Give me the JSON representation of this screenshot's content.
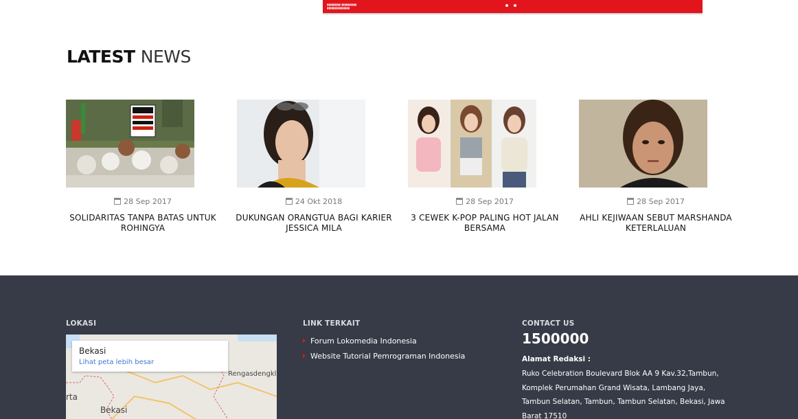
{
  "latest": {
    "title_bold": "LATEST",
    "title_light": "NEWS"
  },
  "news": [
    {
      "date": "28 Sep 2017",
      "title": "SOLIDARITAS TANPA BATAS UNTUK ROHINGYA"
    },
    {
      "date": "24 Okt 2018",
      "title": "DUKUNGAN ORANGTUA BAGI KARIER JESSICA MILA"
    },
    {
      "date": "28 Sep 2017",
      "title": "3 CEWEK K-POP PALING HOT JALAN BERSAMA"
    },
    {
      "date": "28 Sep 2017",
      "title": "AHLI KEJIWAAN SEBUT MARSHANDA KETERLALUAN"
    }
  ],
  "footer": {
    "lokasi": {
      "heading": "LOKASI",
      "map_city": "Bekasi",
      "map_link": "Lihat peta lebih besar",
      "map_label_1": "Rengasdengklok",
      "map_label_2": "Bekasi",
      "map_label_3": "rta"
    },
    "links": {
      "heading": "LINK TERKAIT",
      "items": [
        "Forum Lokomedia Indonesia",
        "Website Tutorial Pemrograman Indonesia"
      ]
    },
    "contact": {
      "heading": "CONTACT US",
      "number": "1500000",
      "address_label": "Alamat Redaksi :",
      "address": "Ruko Celebration Boulevard Blok AA 9 Kav.32,Tambun, Komplek Perumahan Grand Wisata, Lambang Jaya, Tambun Selatan, Tambun, Tambun Selatan, Bekasi, Jawa Barat 17510"
    }
  },
  "colors": {
    "accent": "#e3151c",
    "footer_bg": "#363b47"
  },
  "icons": {
    "date": "calendar-icon",
    "link_bullet": "caret-right-icon"
  }
}
